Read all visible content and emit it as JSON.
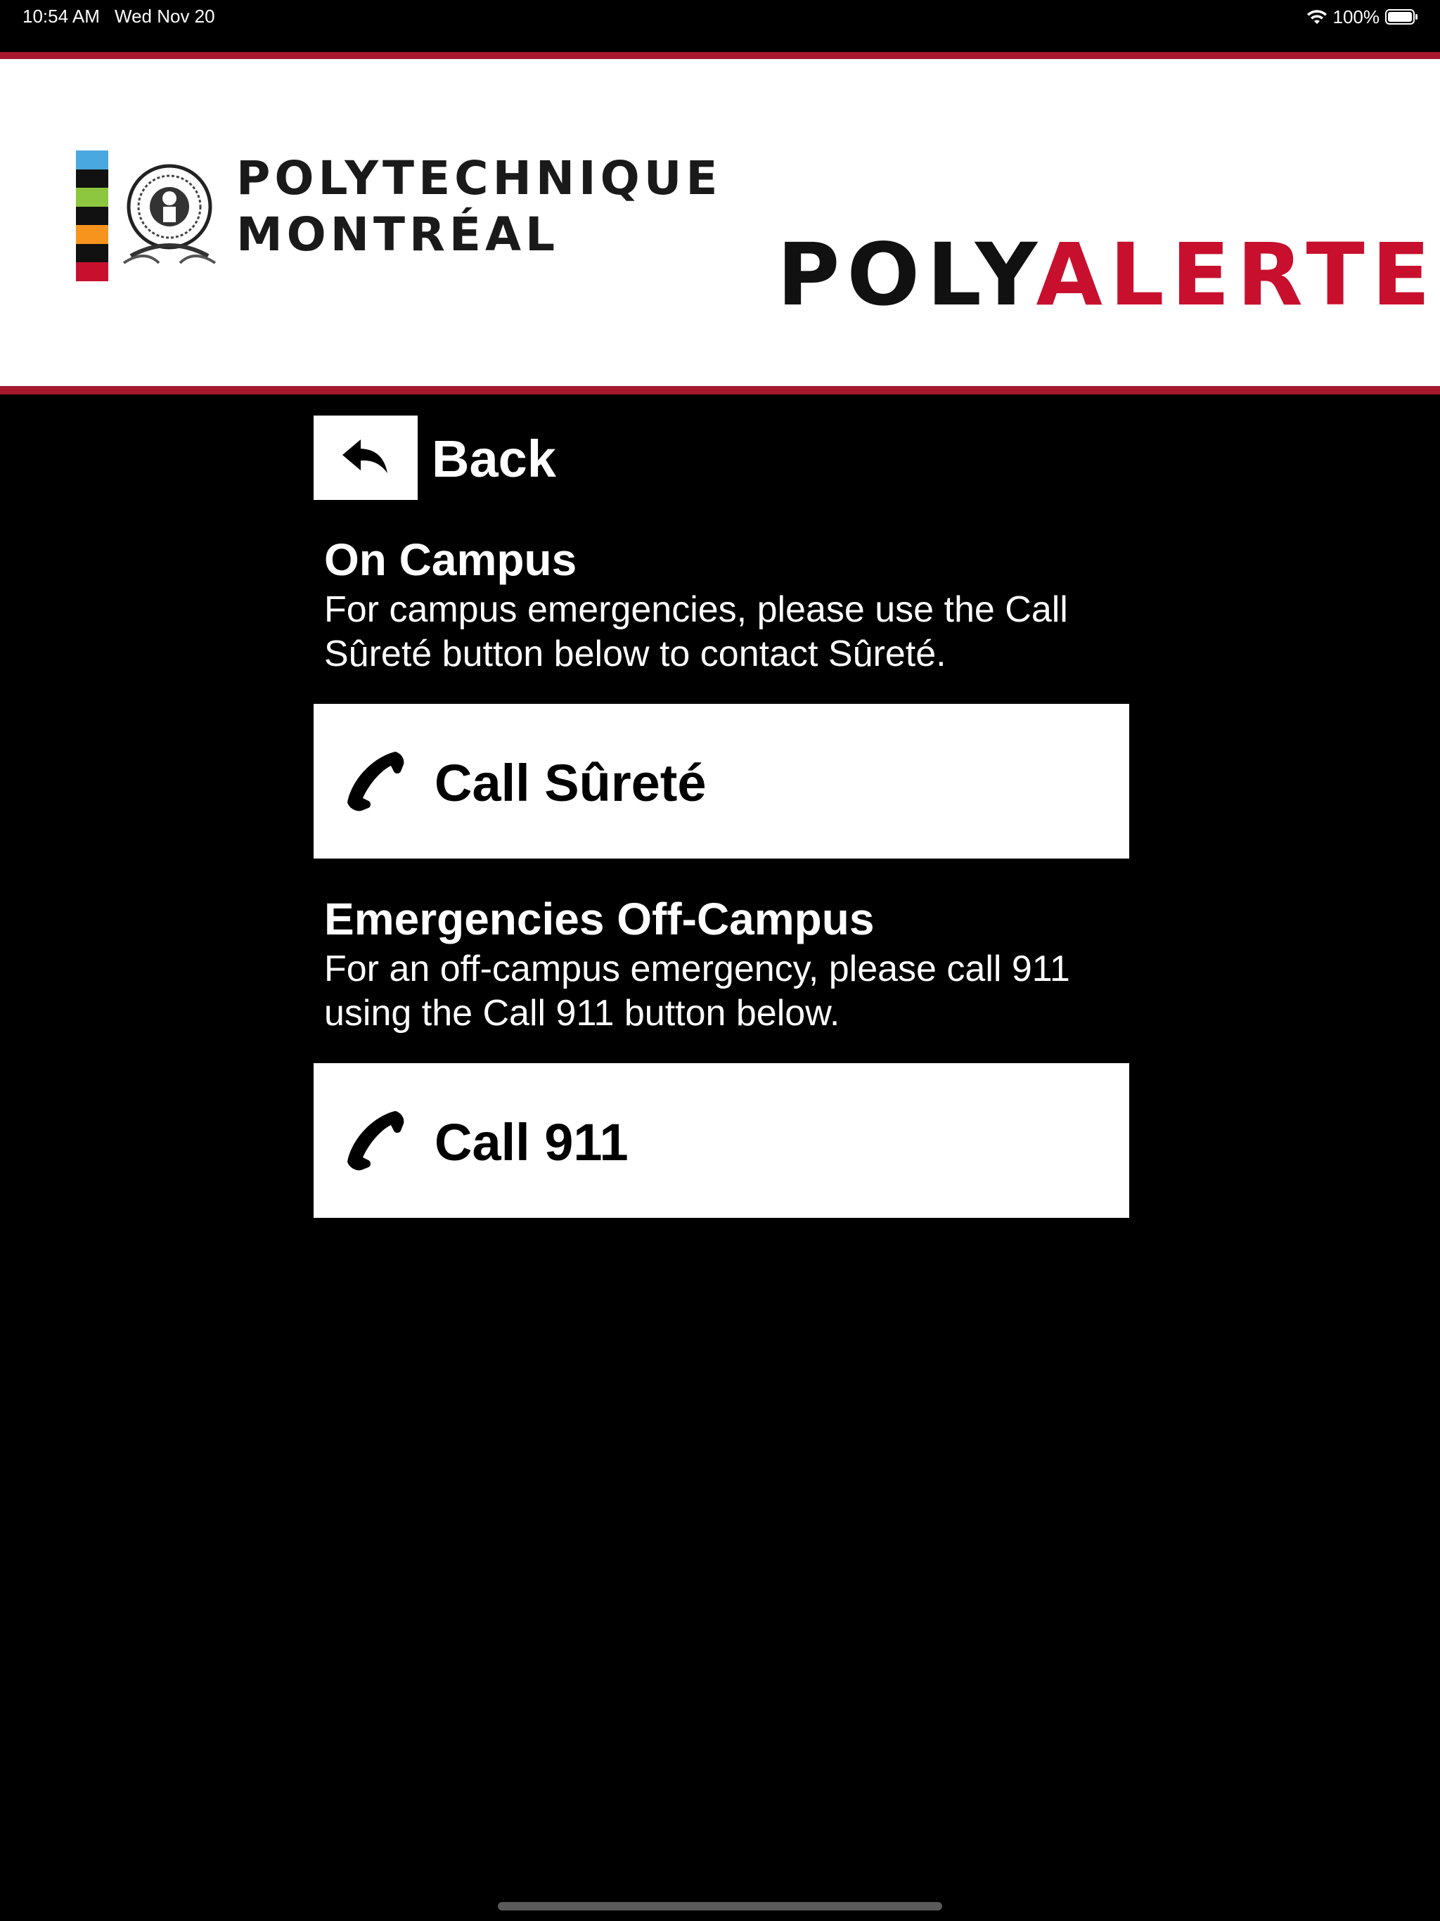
{
  "status_bar": {
    "time": "10:54 AM",
    "date": "Wed Nov 20",
    "battery": "100%"
  },
  "header": {
    "poly_line1": "POLYTECHNIQUE",
    "poly_line2": "MONTRÉAL",
    "alert_brand_part1": "POLY",
    "alert_brand_part2": "ALERTE",
    "colors": {
      "accent_red": "#c8102e",
      "line_red": "#a6192e",
      "colorbar": [
        "#4aa8e0",
        "#111111",
        "#8dc63f",
        "#111111",
        "#f7941d",
        "#111111",
        "#c8102e"
      ]
    }
  },
  "nav": {
    "back_label": "Back",
    "back_icon": "reply-arrow-icon"
  },
  "on_campus": {
    "title": "On Campus",
    "description": "For campus emergencies, please use the Call Sûreté button below to contact Sûreté.",
    "button_label": "Call Sûreté",
    "button_icon": "phone-icon"
  },
  "off_campus": {
    "title": "Emergencies Off-Campus",
    "description": "For an off-campus emergency, please call 911 using the Call 911 button below.",
    "button_label": "Call 911",
    "button_icon": "phone-icon"
  }
}
